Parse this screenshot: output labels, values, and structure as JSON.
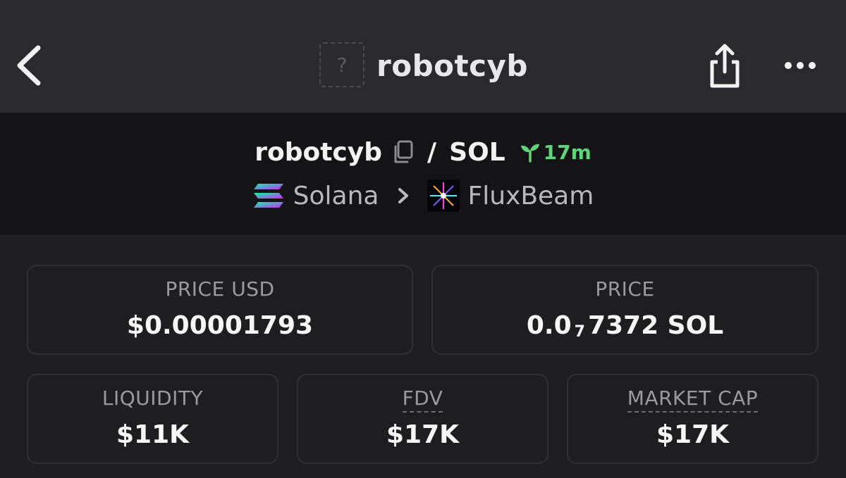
{
  "header": {
    "title": "robotcyb",
    "logo_placeholder": "?"
  },
  "pair": {
    "base": "robotcyb",
    "separator": "/",
    "quote": "SOL",
    "age": "17m",
    "age_color": "#5fd47a",
    "chain": "Solana",
    "dex": "FluxBeam"
  },
  "stats": {
    "price_usd": {
      "label": "PRICE USD",
      "value": "$0.00001793"
    },
    "price": {
      "label": "PRICE",
      "value_prefix": "0.0",
      "value_zeros": "7",
      "value_suffix": "7372 SOL"
    },
    "liquidity": {
      "label": "LIQUIDITY",
      "value": "$11K"
    },
    "fdv": {
      "label": "FDV",
      "value": "$17K"
    },
    "market_cap": {
      "label": "MARKET CAP",
      "value": "$17K"
    }
  },
  "icons": {
    "back": "chevron-left-icon",
    "share": "share-icon",
    "more": "more-horizontal-icon",
    "copy": "copy-icon",
    "age": "seedling-icon",
    "chain": "solana-logo",
    "dex": "fluxbeam-logo",
    "chevron": "chevron-right-icon"
  }
}
